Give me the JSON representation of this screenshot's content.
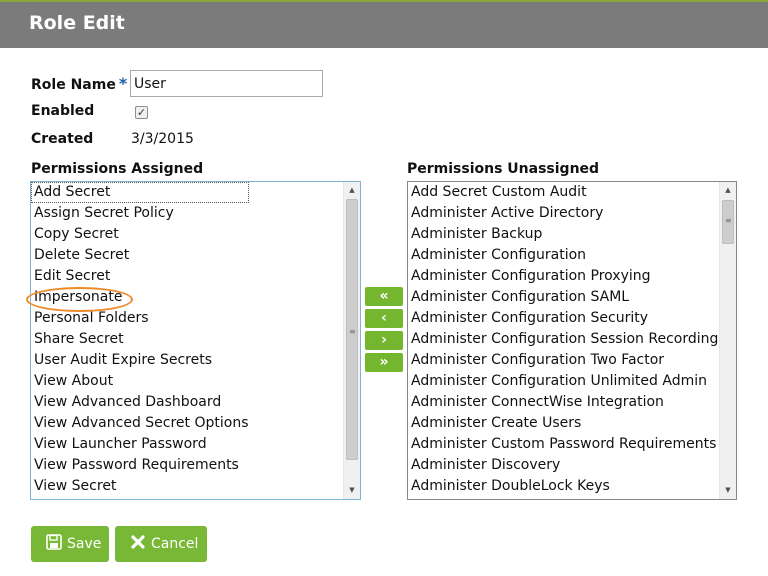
{
  "header": {
    "title": "Role Edit"
  },
  "form": {
    "role_name_label": "Role Name",
    "required_marker": "*",
    "role_name_value": "User",
    "enabled_label": "Enabled",
    "enabled_checked": true,
    "created_label": "Created",
    "created_value": "3/3/2015"
  },
  "assigned": {
    "heading": "Permissions Assigned",
    "items": [
      "Add Secret",
      "Assign Secret Policy",
      "Copy Secret",
      "Delete Secret",
      "Edit Secret",
      "Impersonate",
      "Personal Folders",
      "Share Secret",
      "User Audit Expire Secrets",
      "View About",
      "View Advanced Dashboard",
      "View Advanced Secret Options",
      "View Launcher Password",
      "View Password Requirements",
      "View Secret"
    ],
    "highlighted_item": "Impersonate"
  },
  "unassigned": {
    "heading": "Permissions Unassigned",
    "items": [
      "Add Secret Custom Audit",
      "Administer Active Directory",
      "Administer Backup",
      "Administer Configuration",
      "Administer Configuration Proxying",
      "Administer Configuration SAML",
      "Administer Configuration Security",
      "Administer Configuration Session Recording",
      "Administer Configuration Two Factor",
      "Administer Configuration Unlimited Admin",
      "Administer ConnectWise Integration",
      "Administer Create Users",
      "Administer Custom Password Requirements",
      "Administer Discovery",
      "Administer DoubleLock Keys"
    ]
  },
  "transfer_buttons": {
    "move_all_left": "«",
    "move_left": "‹",
    "move_right": "›",
    "move_all_right": "»"
  },
  "actions": {
    "save_label": "Save",
    "cancel_label": "Cancel",
    "save_icon": "floppy-disk-icon",
    "cancel_icon": "x-icon"
  },
  "colors": {
    "header_bg": "#7b7b7b",
    "accent_green": "#79b836",
    "required_blue": "#1f5ea8",
    "highlight_orange": "#ef8a2c"
  }
}
